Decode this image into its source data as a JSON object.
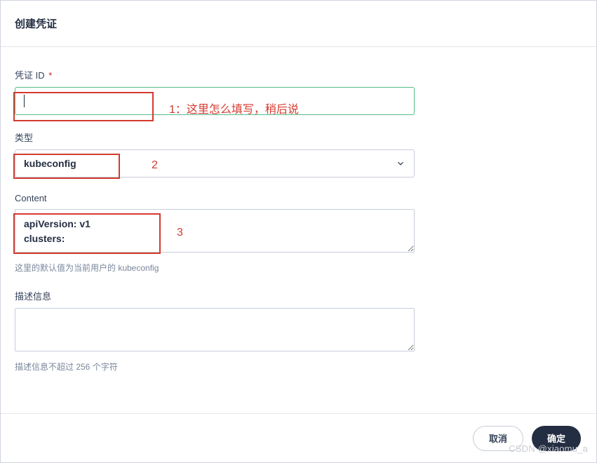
{
  "header": {
    "title": "创建凭证"
  },
  "fields": {
    "id": {
      "label": "凭证 ID",
      "required": "*",
      "value": ""
    },
    "type": {
      "label": "类型",
      "value": "kubeconfig"
    },
    "content": {
      "label": "Content",
      "value": "apiVersion: v1\nclusters:",
      "hint": "这里的默认值为当前用户的 kubeconfig"
    },
    "description": {
      "label": "描述信息",
      "value": "",
      "hint": "描述信息不超过 256 个字符"
    }
  },
  "annotations": {
    "a1": "1：这里怎么填写，稍后说",
    "a2": "2",
    "a3": "3"
  },
  "buttons": {
    "cancel": "取消",
    "confirm": "确定"
  },
  "watermark": "CSDN @xiaomu_a"
}
